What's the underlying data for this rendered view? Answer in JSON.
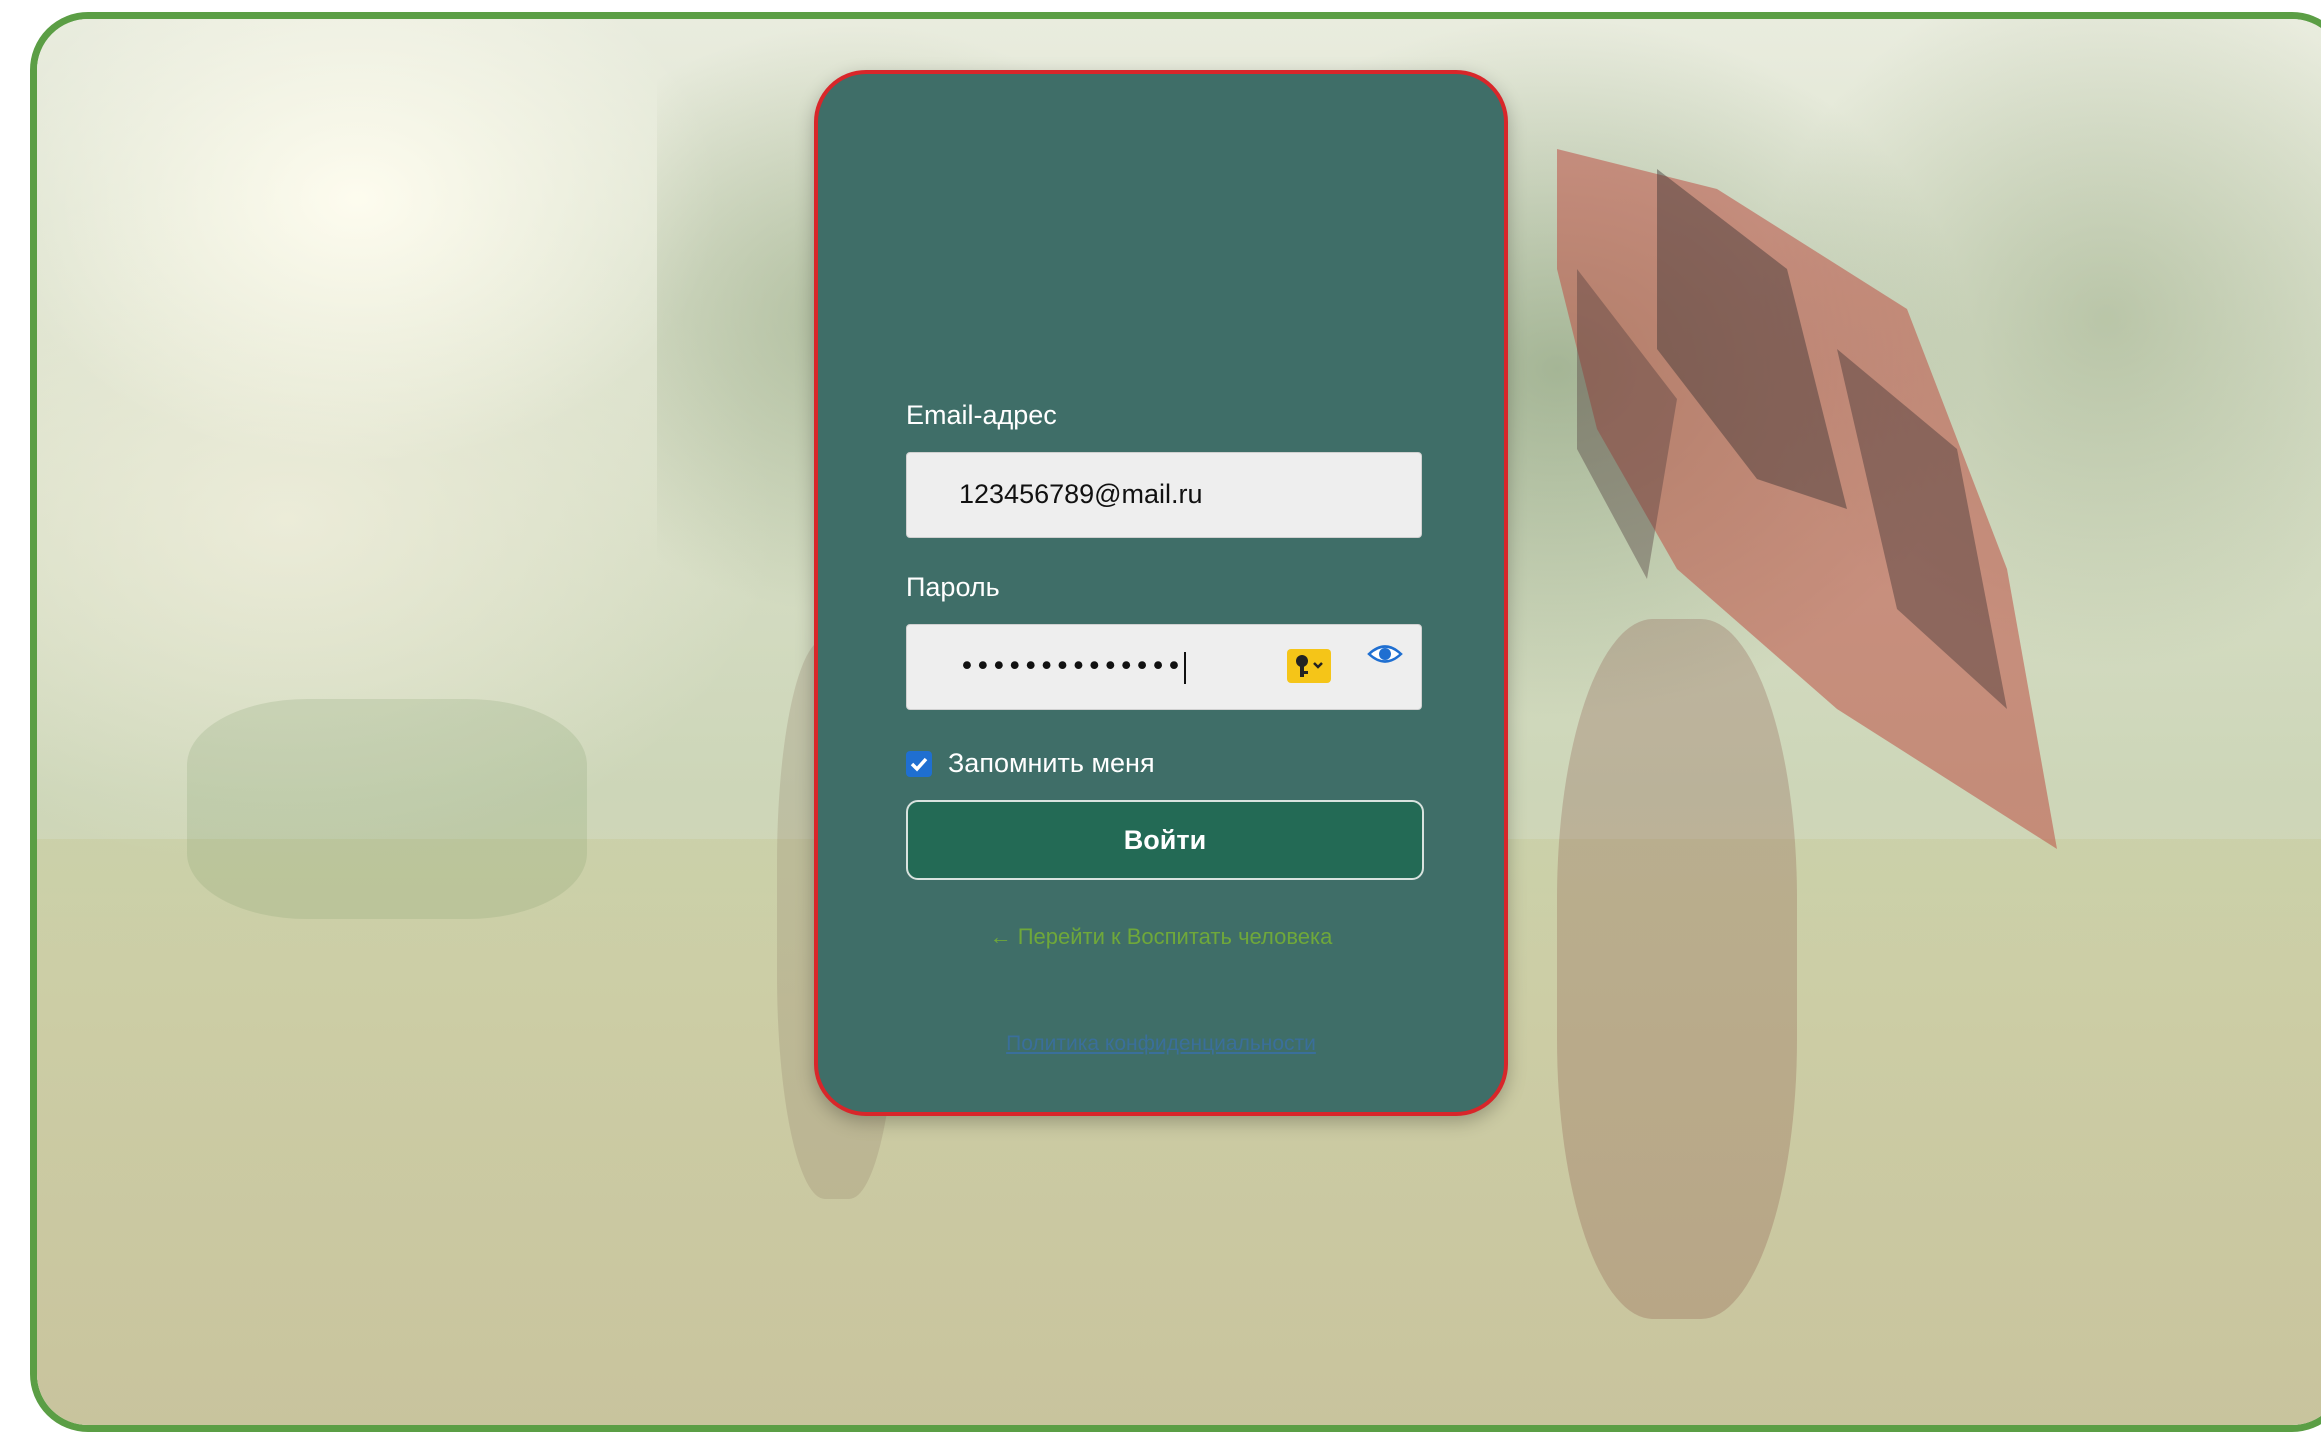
{
  "login": {
    "email_label": "Email-адрес",
    "email_value": "123456789@mail.ru",
    "password_label": "Пароль",
    "password_masked": "••••••••••••••",
    "remember_label": "Запомнить меня",
    "remember_checked": true,
    "submit_label": "Войти",
    "back_link": "← Перейти к Воспитать человека",
    "policy_link": "Политика конфиденциальности"
  },
  "colors": {
    "frame": "#5b9e45",
    "card": "#3f6e68",
    "card_border": "#d8262a",
    "button": "#236a55",
    "back_link": "#6fa83a",
    "checkbox": "#1f6fd1",
    "key_icon": "#f5c518"
  }
}
